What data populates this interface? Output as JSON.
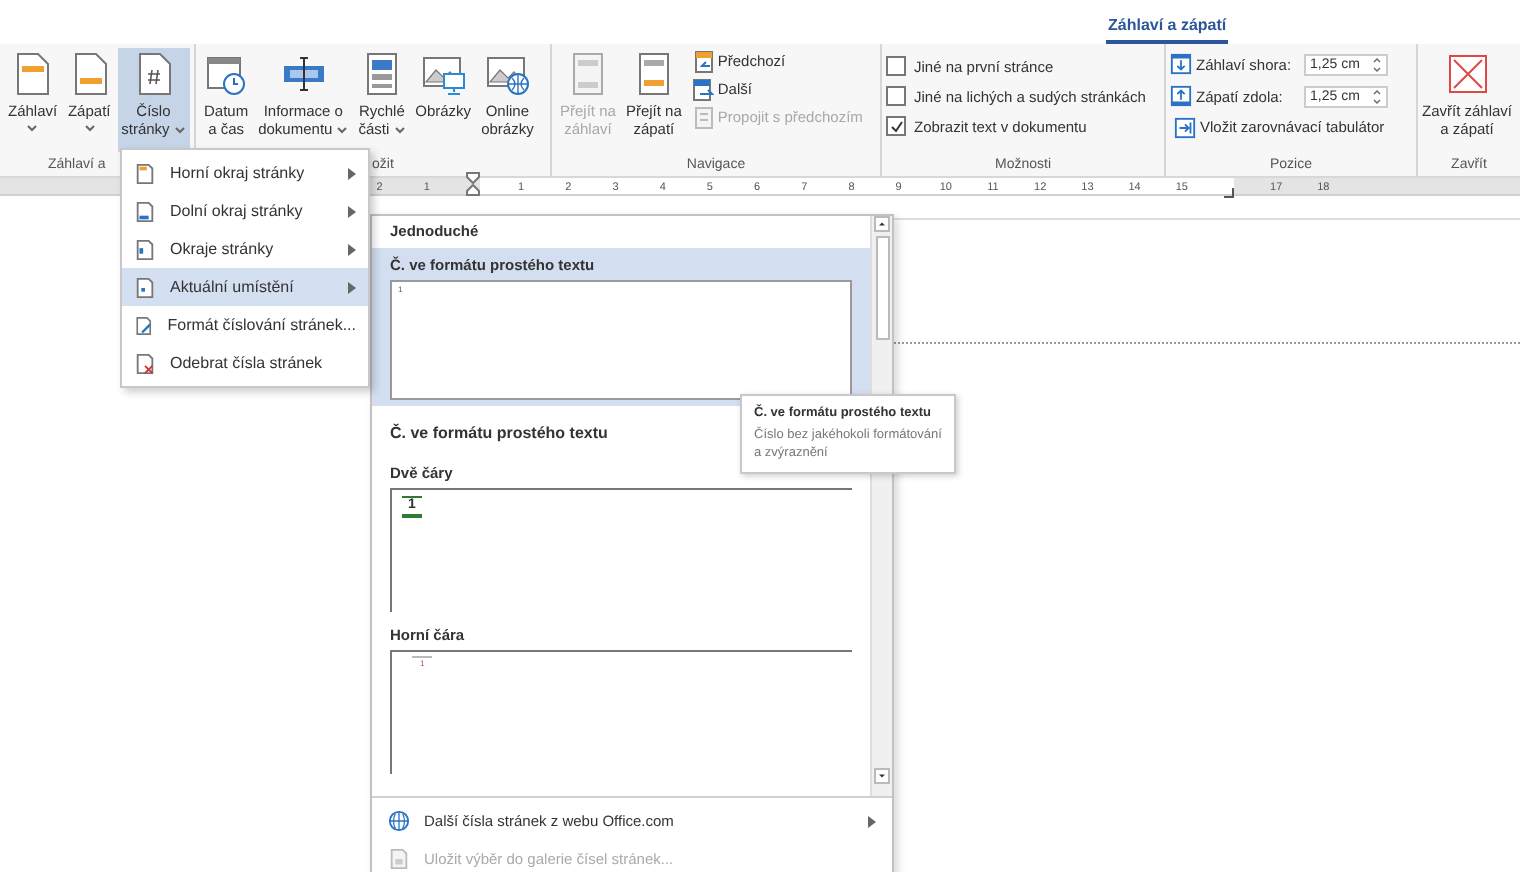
{
  "ribbon_tab": {
    "label": "Záhlaví a zápatí",
    "selected": true
  },
  "groups": [
    {
      "kind": "buttons",
      "label": "Záhlaví a",
      "buttons": [
        {
          "kind": "large",
          "label": "Záhlaví",
          "dropdown": true,
          "selected": false,
          "disabled": false
        },
        {
          "kind": "large",
          "label": "Zápatí",
          "dropdown": true,
          "selected": false,
          "disabled": false
        },
        {
          "kind": "large",
          "label": "Číslo\nstránky",
          "dropdown": true,
          "selected": true,
          "disabled": false
        }
      ]
    },
    {
      "kind": "buttons",
      "label": "ožit",
      "buttons": [
        {
          "kind": "large",
          "label": "Datum\na čas",
          "dropdown": false,
          "selected": false,
          "disabled": false
        },
        {
          "kind": "large",
          "label": "Informace o\ndokumentu",
          "dropdown": true,
          "selected": false,
          "disabled": false
        },
        {
          "kind": "large",
          "label": "Rychlé\nčásti",
          "dropdown": true,
          "selected": false,
          "disabled": false
        },
        {
          "kind": "large",
          "label": "Obrázky",
          "dropdown": false,
          "selected": false,
          "disabled": false
        },
        {
          "kind": "large",
          "label": "Online\nobrázky",
          "dropdown": false,
          "selected": false,
          "disabled": false
        }
      ]
    },
    {
      "kind": "buttons",
      "label": "Navigace",
      "buttons": [
        {
          "kind": "large",
          "label": "Přejít na\nzáhlaví",
          "dropdown": false,
          "selected": false,
          "disabled": true
        },
        {
          "kind": "large",
          "label": "Přejít na\nzápatí",
          "dropdown": false,
          "selected": false,
          "disabled": false
        },
        {
          "kind": "small",
          "label": "Předchozí",
          "selected": false,
          "disabled": false
        },
        {
          "kind": "small",
          "label": "Další",
          "selected": false,
          "disabled": false
        },
        {
          "kind": "small",
          "label": "Propojit s předchozím",
          "selected": false,
          "disabled": true
        }
      ]
    },
    {
      "kind": "checkboxes",
      "label": "Možnosti",
      "checkboxes": [
        {
          "label": "Jiné na první stránce",
          "checked": false
        },
        {
          "label": "Jiné na lichých a sudých stránkách",
          "checked": false
        },
        {
          "label": "Zobrazit text v dokumentu",
          "checked": true
        }
      ]
    },
    {
      "kind": "position",
      "label": "Pozice",
      "fields": [
        {
          "label": "Záhlaví shora:",
          "value": "1,25 cm"
        },
        {
          "label": "Zápatí zdola:",
          "value": "1,25 cm"
        }
      ],
      "button": "Vložit zarovnávací tabulátor"
    },
    {
      "kind": "buttons",
      "label": "Zavřít",
      "buttons": [
        {
          "kind": "large",
          "label": "Zavřít záhlaví\na zápatí",
          "dropdown": false,
          "selected": false,
          "disabled": false
        }
      ]
    }
  ],
  "ruler": [
    {
      "kind": "number",
      "label": "2"
    },
    {
      "kind": "number",
      "label": "1"
    },
    {
      "kind": "indent-marker"
    },
    {
      "kind": "number",
      "label": "1"
    },
    {
      "kind": "number",
      "label": "2"
    },
    {
      "kind": "number",
      "label": "3"
    },
    {
      "kind": "number",
      "label": "4"
    },
    {
      "kind": "number",
      "label": "5"
    },
    {
      "kind": "number",
      "label": "6"
    },
    {
      "kind": "number",
      "label": "7"
    },
    {
      "kind": "number",
      "label": "8"
    },
    {
      "kind": "number",
      "label": "9"
    },
    {
      "kind": "number",
      "label": "10"
    },
    {
      "kind": "number",
      "label": "11"
    },
    {
      "kind": "number",
      "label": "12"
    },
    {
      "kind": "number",
      "label": "13"
    },
    {
      "kind": "number",
      "label": "14"
    },
    {
      "kind": "number",
      "label": "15"
    },
    {
      "kind": "tab-marker"
    },
    {
      "kind": "number",
      "label": "17"
    },
    {
      "kind": "number",
      "label": "18"
    }
  ],
  "page_number_menu": [
    {
      "label": "Horní okraj stránky",
      "submenu": true,
      "selected": false
    },
    {
      "label": "Dolní okraj stránky",
      "submenu": true,
      "selected": false
    },
    {
      "label": "Okraje stránky",
      "submenu": true,
      "selected": false
    },
    {
      "label": "Aktuální umístění",
      "submenu": true,
      "selected": true
    },
    {
      "label": "Formát číslování stránek...",
      "submenu": false,
      "selected": false
    },
    {
      "label": "Odebrat čísla stránek",
      "submenu": false,
      "selected": false
    }
  ],
  "gallery": {
    "entries": [
      {
        "kind": "category",
        "label": "Jednoduché"
      },
      {
        "kind": "item",
        "title": "Č. ve formátu prostého textu",
        "selected": true,
        "number": "1"
      },
      {
        "kind": "heading",
        "label": "Č. ve formátu prostého textu"
      },
      {
        "kind": "item",
        "title": "Dvě čáry",
        "selected": false,
        "number": "1"
      },
      {
        "kind": "item",
        "title": "Horní čára",
        "selected": false,
        "number": "1"
      }
    ],
    "footer": [
      {
        "label": "Další čísla stránek z webu Office.com",
        "submenu": true,
        "disabled": false
      },
      {
        "label": "Uložit výběr do galerie čísel stránek...",
        "submenu": false,
        "disabled": true
      }
    ]
  },
  "tooltip": {
    "title": "Č. ve formátu prostého textu",
    "text": "Číslo bez jakéhokoli formátování a zvýraznění"
  }
}
